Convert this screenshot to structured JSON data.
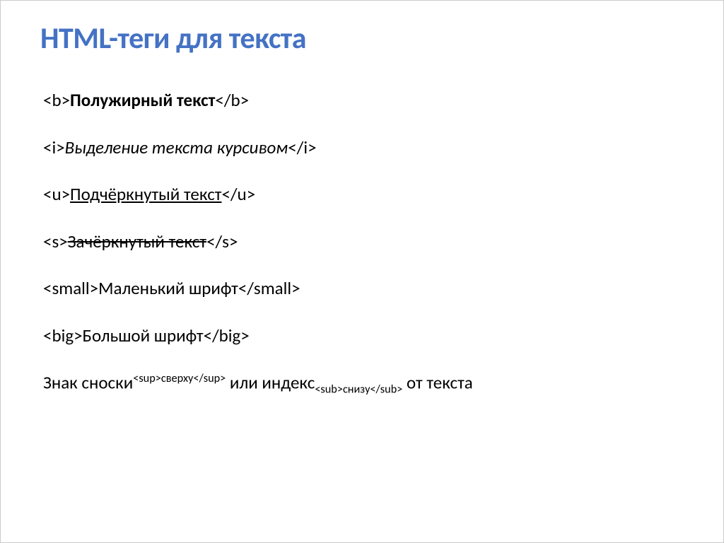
{
  "title": "HTML-теги для текста",
  "examples": {
    "bold": {
      "open": "<b>",
      "text": "Полужирный текст",
      "close": "</b>"
    },
    "italic": {
      "open": "<i>",
      "text": "Выделение текста курсивом",
      "close": "</i>"
    },
    "underline": {
      "open": "<u>",
      "text": "Подчёркнутый текст",
      "close": "</u>"
    },
    "strike": {
      "open": "<s>",
      "text": "Зачёркнутый текст",
      "close": "</s>"
    },
    "small": {
      "open": "<small>",
      "text": "Маленький шрифт",
      "close": "</small>"
    },
    "big": {
      "open": "<big>",
      "text": "Большой шрифт",
      "close": "</big>"
    },
    "supsub": {
      "prefix": "Знак сноски",
      "sup_open": "<sup>",
      "sup_text": "сверху",
      "sup_close": "</sup>",
      "middle": " или индекс",
      "sub_open": "<sub>",
      "sub_text": "снизу",
      "sub_close": "</sub>",
      "suffix": " от текста"
    }
  }
}
